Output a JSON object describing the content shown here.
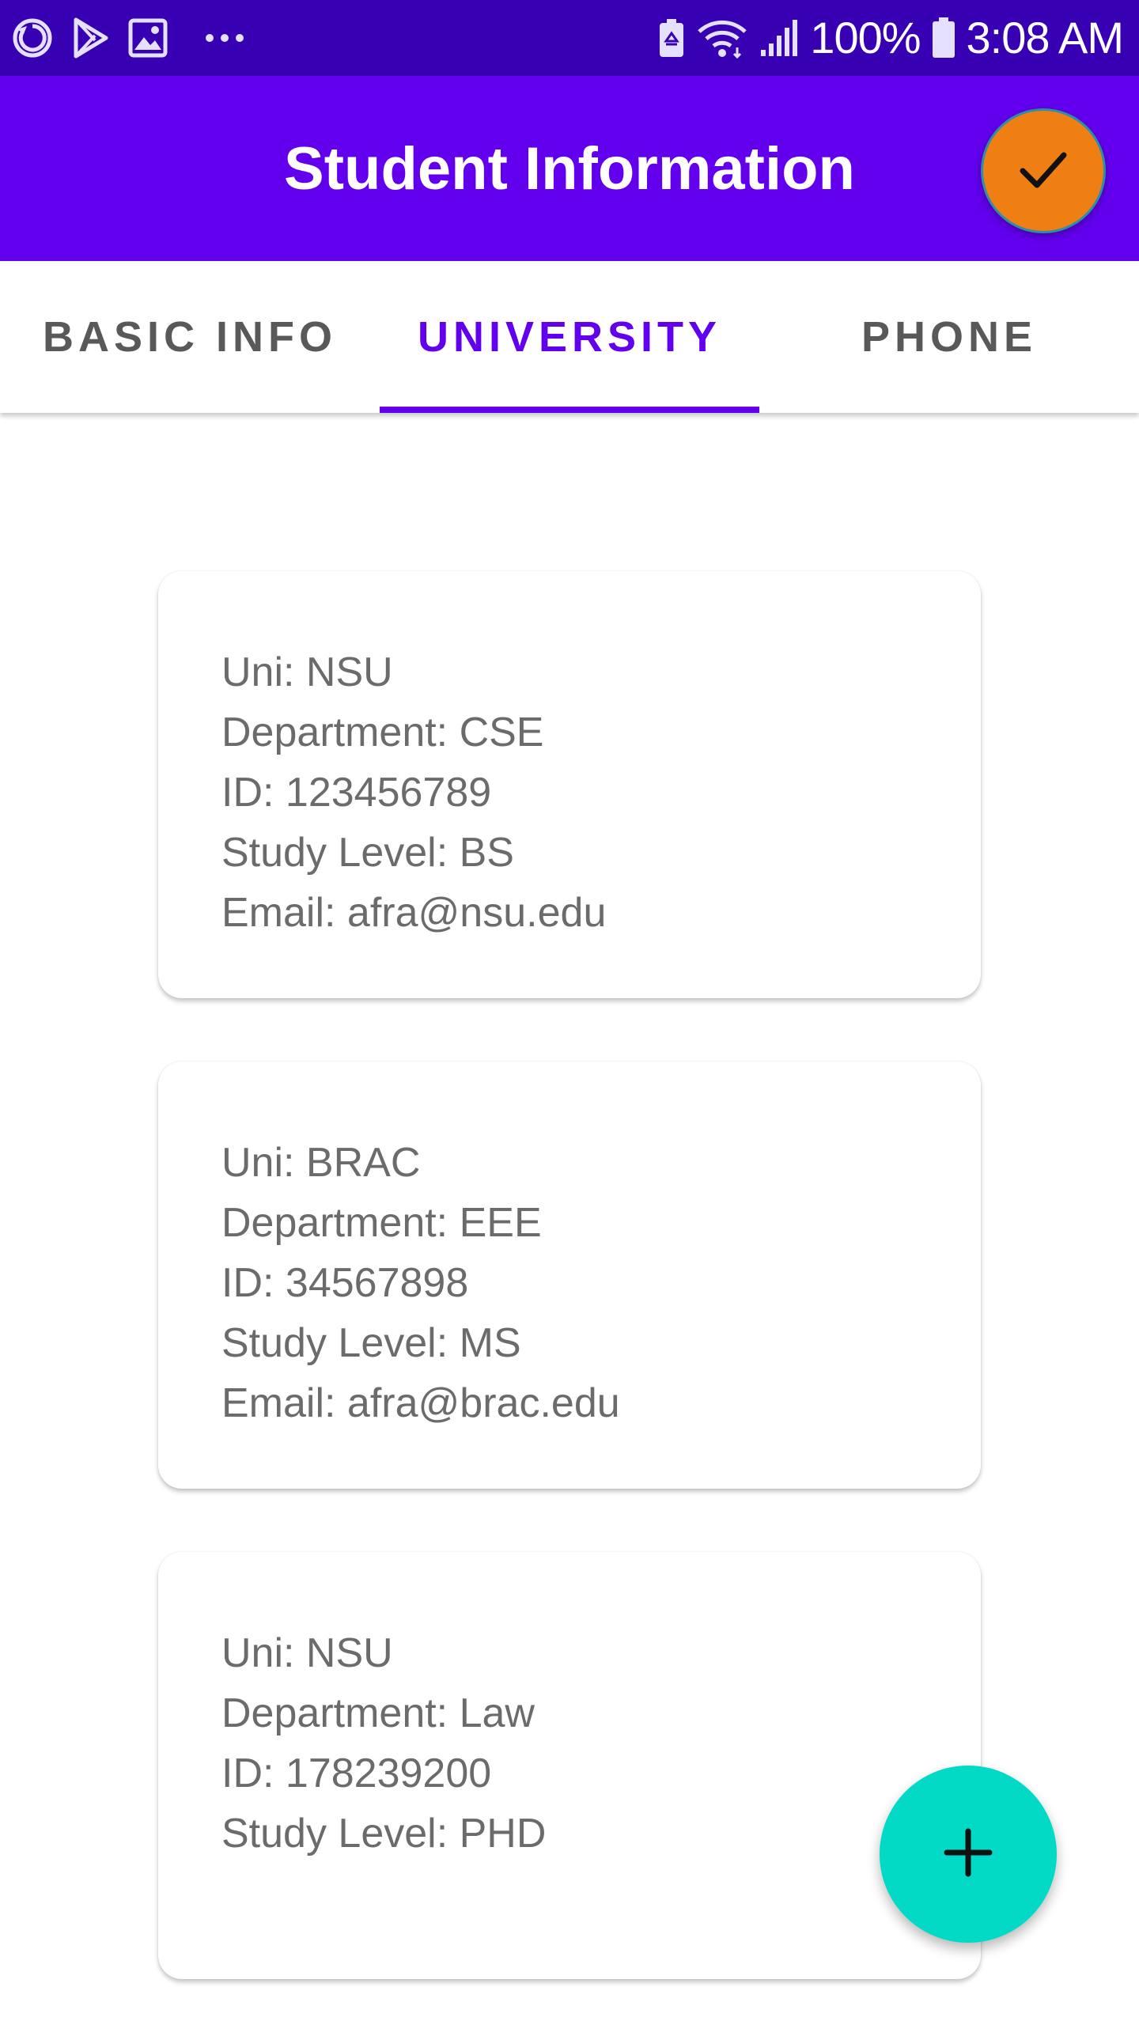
{
  "status_bar": {
    "battery_percent": "100%",
    "time": "3:08 AM",
    "left_icons": [
      "sync-icon",
      "play-store-icon",
      "gallery-icon",
      "more-dots-icon"
    ],
    "right_icons": [
      "battery-saver-icon",
      "wifi-icon",
      "signal-icon",
      "battery-icon"
    ]
  },
  "app_bar": {
    "title": "Student Information",
    "action_icon": "check-icon",
    "action_color": "#f07f13"
  },
  "tabs": [
    {
      "label": "BASIC INFO",
      "active": false
    },
    {
      "label": "UNIVERSITY",
      "active": true
    },
    {
      "label": "PHONE",
      "active": false
    }
  ],
  "cards": [
    {
      "lines": [
        "Uni: NSU",
        "Department: CSE",
        "ID: 123456789",
        "Study Level: BS",
        "Email: afra@nsu.edu"
      ]
    },
    {
      "lines": [
        "Uni: BRAC",
        "Department: EEE",
        "ID: 34567898",
        "Study Level: MS",
        "Email: afra@brac.edu"
      ]
    },
    {
      "lines": [
        "Uni: NSU",
        "Department: Law",
        "ID: 178239200",
        "Study Level: PHD"
      ]
    }
  ],
  "fab": {
    "icon": "plus-icon",
    "color": "#03dac5"
  },
  "colors": {
    "status_bar": "#3700b3",
    "primary": "#6200ee",
    "tab_inactive": "#595959",
    "card_text": "#6b6b6b"
  }
}
